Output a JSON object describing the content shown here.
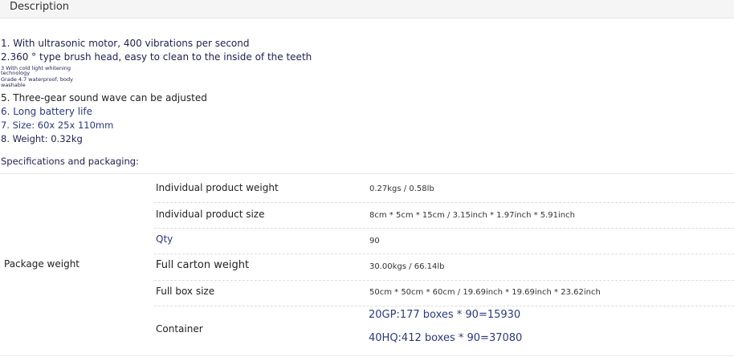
{
  "tab": {
    "description_label": "Description"
  },
  "features": [
    "1. With ultrasonic motor, 400 vibrations per second",
    "2.360 ° type brush head, easy to clean to the inside of the teeth",
    "3 With cold light whitening",
    "technology",
    "Grade 4.7 waterproof, body",
    "washable",
    "5. Three-gear sound wave can be adjusted",
    "6. Long battery life",
    "7. Size: 60x 25x 110mm",
    "8. Weight: 0.32kg"
  ],
  "specs_title": "Specifications and packaging:",
  "spec_group_label": "Package weight",
  "spec_rows": [
    {
      "label": "Individual product weight",
      "value": "0.27kgs / 0.58lb"
    },
    {
      "label": "Individual product size",
      "value": "8cm * 5cm * 15cm / 3.15inch * 1.97inch * 5.91inch"
    },
    {
      "label": "Qty",
      "value": "90"
    },
    {
      "label": "Full carton weight",
      "value": "30.00kgs / 66.14lb"
    },
    {
      "label": "Full box size",
      "value": "50cm * 50cm * 60cm / 19.69inch * 19.69inch * 23.62inch"
    },
    {
      "label": "Container",
      "values": [
        "20GP:177 boxes * 90=15930",
        "40HQ:412 boxes * 90=37080"
      ]
    }
  ]
}
